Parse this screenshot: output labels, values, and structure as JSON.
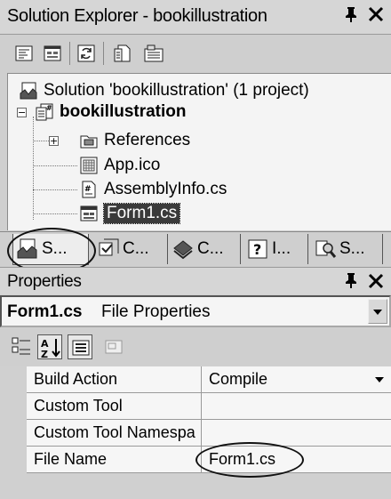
{
  "solution_explorer": {
    "title": "Solution Explorer - bookillustration",
    "pin_glyph": "ₚ",
    "close_glyph": "✕",
    "toolbar": [
      "view-code-icon",
      "view-designer-icon",
      "refresh-icon",
      "show-all-files-icon",
      "properties-icon"
    ],
    "tree": {
      "solution": "Solution 'bookillustration' (1 project)",
      "project": "bookillustration",
      "items": [
        {
          "label": "References",
          "icon": "references-icon"
        },
        {
          "label": "App.ico",
          "icon": "ico-file-icon"
        },
        {
          "label": "AssemblyInfo.cs",
          "icon": "cs-file-icon"
        },
        {
          "label": "Form1.cs",
          "icon": "form-file-icon"
        }
      ]
    },
    "tabs": [
      {
        "label": "S...",
        "icon": "solution-explorer-icon",
        "active": true
      },
      {
        "label": "C...",
        "icon": "class-view-icon"
      },
      {
        "label": "C...",
        "icon": "contents-icon"
      },
      {
        "label": "I...",
        "icon": "index-icon"
      },
      {
        "label": "S...",
        "icon": "search-icon"
      }
    ]
  },
  "properties": {
    "title": "Properties",
    "pin_glyph": "ₚ",
    "close_glyph": "✕",
    "object_name": "Form1.cs",
    "object_type": "File Properties",
    "toolbar": [
      "categorized-icon",
      "alphabetical-icon",
      "property-pages-icon",
      "events-icon"
    ],
    "rows": [
      {
        "name": "Build Action",
        "value": "Compile",
        "has_dropdown": true
      },
      {
        "name": "Custom Tool",
        "value": ""
      },
      {
        "name": "Custom Tool Namespa",
        "value": ""
      },
      {
        "name": "File Name",
        "value": "Form1.cs"
      }
    ]
  },
  "colors": {
    "selection_bg": "#3a3a3a",
    "window_bg": "#cfcfcf",
    "panel_bg": "#f4f4f4"
  }
}
